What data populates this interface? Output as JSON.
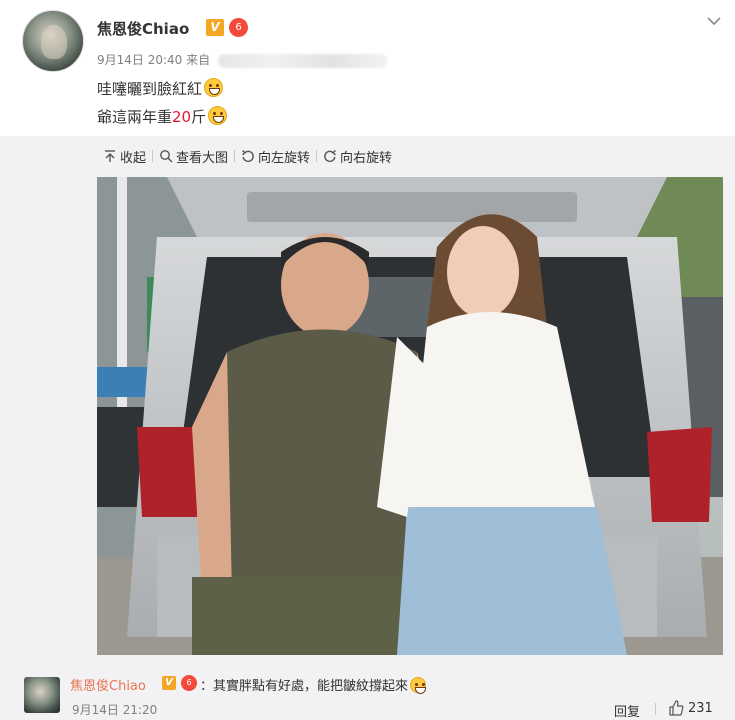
{
  "post": {
    "username": "焦恩俊Chiao",
    "verified_badge": "V",
    "level_badge": "6",
    "date": "9月14日 20:40",
    "source_prefix": "来自",
    "line1": "哇噻曬到臉紅紅",
    "line2_prefix": "爺這兩年重",
    "line2_number": "20",
    "line2_suffix": "斤"
  },
  "toolbar": {
    "collapse": "收起",
    "view_large": "查看大图",
    "rotate_left": "向左旋转",
    "rotate_right": "向右旋转"
  },
  "comment": {
    "username": "焦恩俊Chiao",
    "verified_badge": "V",
    "level_badge": "6",
    "text": "：其實胖點有好處，能把皺紋撐起來",
    "time": "9月14日 21:20",
    "reply": "回复",
    "likes": "231"
  },
  "colors": {
    "accent_red": "#e6162d",
    "comment_username": "#eb7350",
    "verified": "#f5a623",
    "panel_bg": "#f2f2f5"
  },
  "icons": [
    "chevron-down-icon",
    "collapse-icon",
    "search-icon",
    "rotate-left-icon",
    "rotate-right-icon",
    "like-icon",
    "smile-emoji-icon"
  ]
}
